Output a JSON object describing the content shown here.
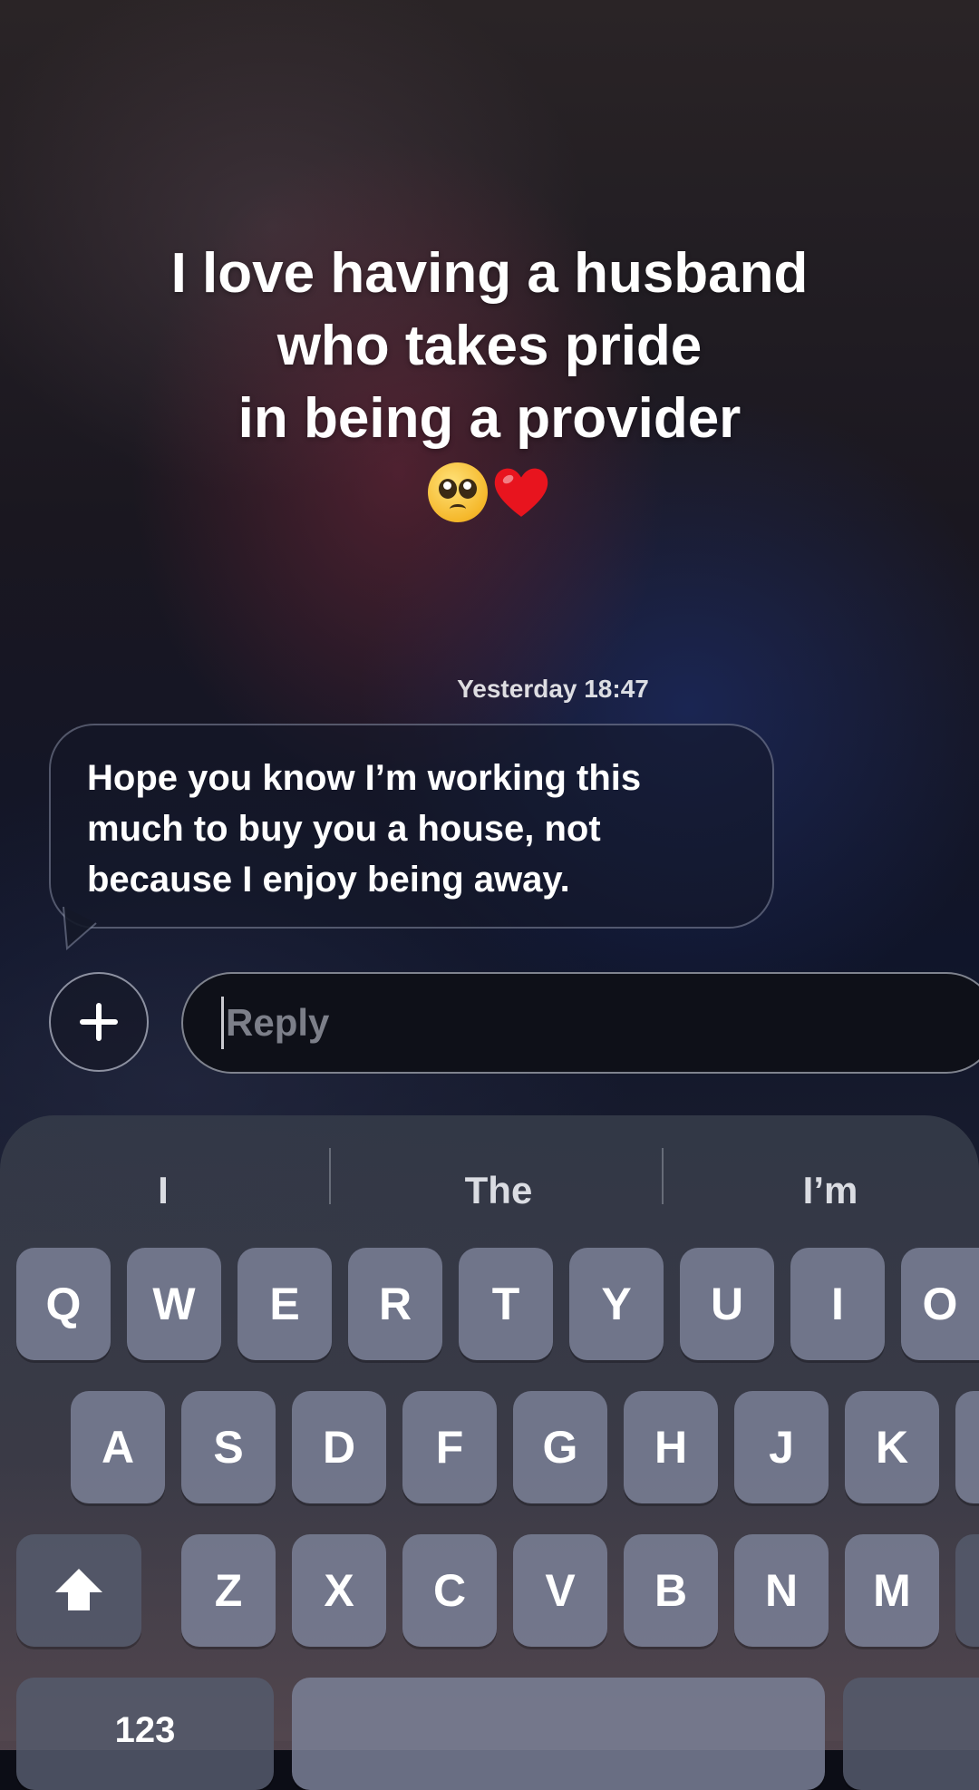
{
  "caption": {
    "lines": [
      "I love having a husband",
      "who takes pride",
      "in being a provider"
    ],
    "emojis": [
      "pleading-face",
      "red-heart"
    ]
  },
  "message": {
    "timestamp": "Yesterday 18:47",
    "lines": [
      "Hope you know I’m working this",
      "much to buy you a house, not",
      "because I enjoy being away."
    ]
  },
  "composer": {
    "plus_icon": "plus-icon",
    "reply_placeholder": "Reply"
  },
  "keyboard": {
    "predictions": [
      "I",
      "The",
      "I’m"
    ],
    "row1": [
      "Q",
      "W",
      "E",
      "R",
      "T",
      "Y",
      "U",
      "I",
      "O"
    ],
    "row2": [
      "A",
      "S",
      "D",
      "F",
      "G",
      "H",
      "J",
      "K"
    ],
    "row3": [
      "Z",
      "X",
      "C",
      "V",
      "B",
      "N",
      "M"
    ],
    "shift_icon": "shift-icon",
    "numbers_label": "123"
  }
}
